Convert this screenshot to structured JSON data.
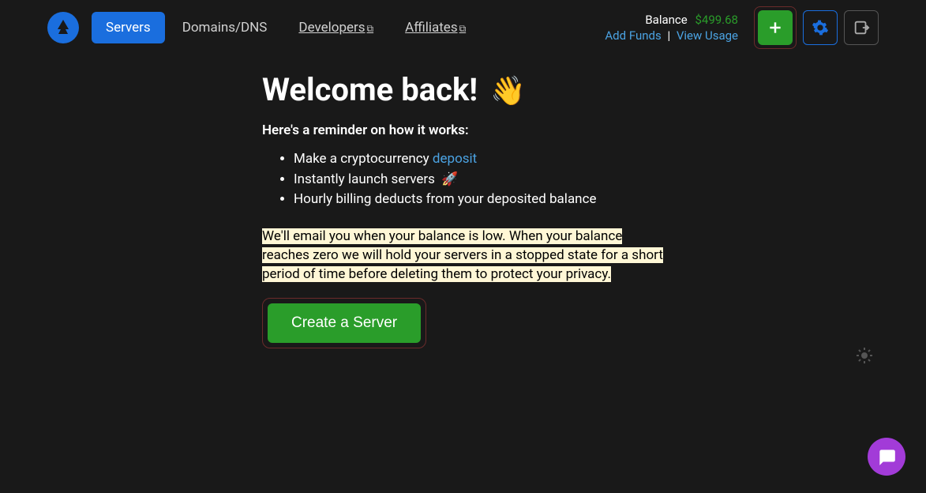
{
  "nav": {
    "servers": "Servers",
    "domains": "Domains/DNS",
    "developers": "Developers",
    "affiliates": "Affiliates"
  },
  "balance": {
    "label": "Balance",
    "amount": "$499.68",
    "add_funds": "Add Funds",
    "view_usage": "View Usage"
  },
  "welcome": {
    "title": "Welcome back!",
    "subtitle": "Here's a reminder on how it works:",
    "bullet1_pre": "Make a cryptocurrency ",
    "bullet1_link": "deposit",
    "bullet2": "Instantly launch servers ",
    "bullet3": "Hourly billing deducts from your deposited balance",
    "info": " We'll email you when your balance is low. When your balance reaches zero we will hold your servers in a stopped state for a short period of time before deleting them to protect your privacy. ",
    "create_button": "Create a Server"
  }
}
